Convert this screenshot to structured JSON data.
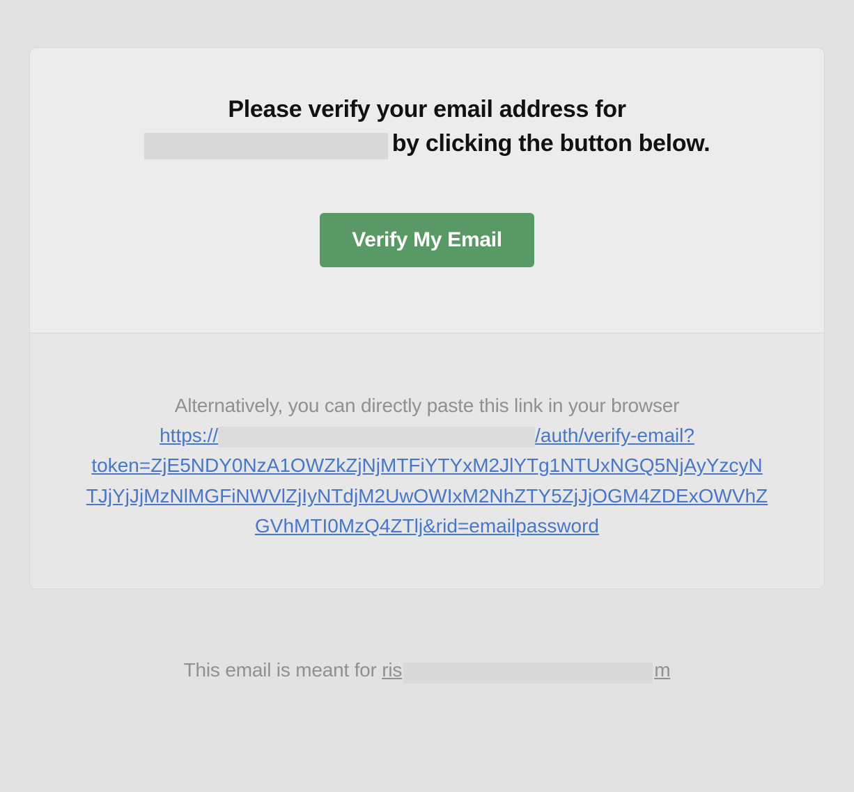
{
  "heading": {
    "part1": "Please verify your email address for",
    "part2": "by clicking the button below."
  },
  "button": {
    "verify_label": "Verify My Email"
  },
  "alternative": {
    "intro": "Alternatively, you can directly paste this link in your browser",
    "link_prefix": "https://",
    "link_suffix": "/auth/verify-email?token=ZjE5NDY0NzA1OWZkZjNjMTFiYTYxM2JlYTg1NTUxNGQ5NjAyYzcyNTJjYjJjMzNlMGFiNWVlZjIyNTdjM2UwOWIxM2NhZTY5ZjJjOGM4ZDExOWVhZGVhMTI0MzQ4ZTlj&rid=emailpassword"
  },
  "footer": {
    "prefix": "This email is meant for ",
    "recipient_visible_start": "ris",
    "recipient_visible_end": "m"
  }
}
